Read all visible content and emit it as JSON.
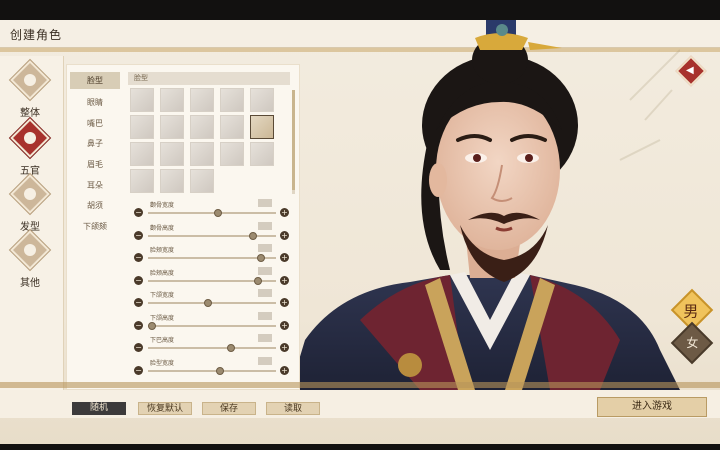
{
  "window": {
    "title": "创建角色"
  },
  "nav": {
    "items": [
      {
        "label": "整体",
        "icon": "body-icon",
        "active": false
      },
      {
        "label": "五官",
        "icon": "face-icon",
        "active": true
      },
      {
        "label": "发型",
        "icon": "hair-icon",
        "active": false
      },
      {
        "label": "其他",
        "icon": "other-icon",
        "active": false
      }
    ]
  },
  "subtabs": [
    "脸型",
    "眼睛",
    "嘴巴",
    "鼻子",
    "眉毛",
    "耳朵",
    "胡须",
    "下颌颏"
  ],
  "grid": {
    "header": "脸型",
    "selected_index": 9
  },
  "sliders": [
    {
      "label": "颧骨宽度",
      "value": 0.55
    },
    {
      "label": "颧骨高度",
      "value": 0.82
    },
    {
      "label": "脸颊宽度",
      "value": 0.88
    },
    {
      "label": "脸颊高度",
      "value": 0.86
    },
    {
      "label": "下颌宽度",
      "value": 0.47
    },
    {
      "label": "下颌高度",
      "value": 0.03
    },
    {
      "label": "下巴高度",
      "value": 0.65
    },
    {
      "label": "脸型宽度",
      "value": 0.56
    }
  ],
  "gender": {
    "male": "男",
    "female": "女",
    "selected": "male"
  },
  "footer": {
    "random": "随机",
    "reset": "恢复默认",
    "save": "保存",
    "load": "读取",
    "enter": "进入游戏"
  },
  "colors": {
    "accent_red": "#a8322d",
    "gold": "#f0c35c",
    "paper": "#f3ecdf"
  }
}
